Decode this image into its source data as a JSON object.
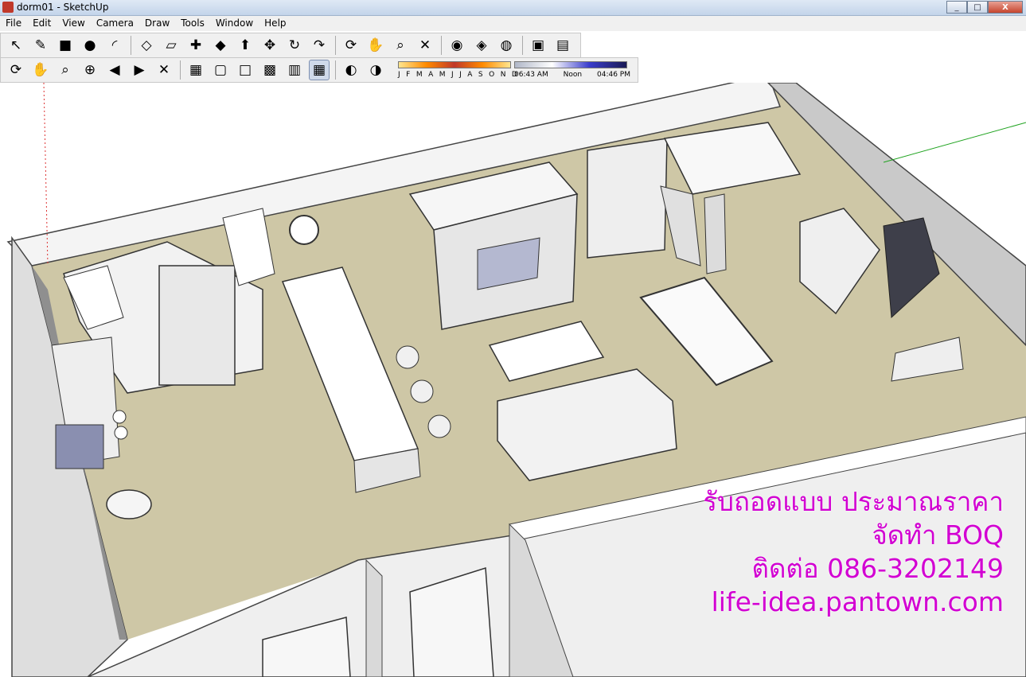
{
  "window": {
    "title": "dorm01 - SketchUp",
    "min_label": "_",
    "max_label": "□",
    "close_label": "X"
  },
  "menu": [
    "File",
    "Edit",
    "View",
    "Camera",
    "Draw",
    "Tools",
    "Window",
    "Help"
  ],
  "toolbar_top": [
    {
      "name": "select",
      "glyph": "↖"
    },
    {
      "name": "pencil",
      "glyph": "✎"
    },
    {
      "name": "rectangle",
      "glyph": "■"
    },
    {
      "name": "circle",
      "glyph": "●"
    },
    {
      "name": "arc",
      "glyph": "◜"
    },
    {
      "name": "make-component",
      "glyph": "◇"
    },
    {
      "name": "eraser",
      "glyph": "▱"
    },
    {
      "name": "tape-measure",
      "glyph": "✚"
    },
    {
      "name": "paint-bucket",
      "glyph": "◆"
    },
    {
      "name": "push-pull",
      "glyph": "⬆"
    },
    {
      "name": "move",
      "glyph": "✥"
    },
    {
      "name": "rotate",
      "glyph": "↻"
    },
    {
      "name": "follow-me",
      "glyph": "↷"
    },
    {
      "name": "orbit",
      "glyph": "⟳"
    },
    {
      "name": "pan",
      "glyph": "✋"
    },
    {
      "name": "zoom",
      "glyph": "⌕"
    },
    {
      "name": "zoom-extents",
      "glyph": "✕"
    },
    {
      "name": "get-models",
      "glyph": "◉"
    },
    {
      "name": "share-model",
      "glyph": "◈"
    },
    {
      "name": "google-earth",
      "glyph": "◍"
    },
    {
      "name": "get-components",
      "glyph": "▣"
    },
    {
      "name": "share-component",
      "glyph": "▤"
    }
  ],
  "toolbar_bottom": [
    {
      "name": "orbit",
      "glyph": "⟳"
    },
    {
      "name": "pan",
      "glyph": "✋"
    },
    {
      "name": "zoom",
      "glyph": "⌕"
    },
    {
      "name": "zoom-window",
      "glyph": "⊕"
    },
    {
      "name": "previous-view",
      "glyph": "◀"
    },
    {
      "name": "next-view",
      "glyph": "▶"
    },
    {
      "name": "zoom-extents",
      "glyph": "✕"
    }
  ],
  "style_buttons": [
    {
      "name": "x-ray",
      "glyph": "▦"
    },
    {
      "name": "wireframe",
      "glyph": "▢"
    },
    {
      "name": "hidden-line",
      "glyph": "□"
    },
    {
      "name": "shaded",
      "glyph": "▩"
    },
    {
      "name": "shaded-textures",
      "glyph": "▥"
    },
    {
      "name": "monochrome",
      "glyph": "▦"
    }
  ],
  "shadow_buttons": [
    {
      "name": "shadow-settings",
      "glyph": "◐"
    },
    {
      "name": "display-shadows",
      "glyph": "◑"
    }
  ],
  "shadows": {
    "months": [
      "J",
      "F",
      "M",
      "A",
      "M",
      "J",
      "J",
      "A",
      "S",
      "O",
      "N",
      "D"
    ],
    "time_start": "06:43 AM",
    "time_mid": "Noon",
    "time_end": "04:46 PM"
  },
  "overlay": {
    "line1": "รับถอดแบบ ประมาณราคา",
    "line2": "จัดทำ BOQ",
    "line3": "ติดต่อ 086-3202149",
    "line4": "life-idea.pantown.com"
  },
  "colors": {
    "floor": "#cec7a6",
    "walls": "#f4f4f4",
    "accent_magenta": "#d200d2"
  }
}
